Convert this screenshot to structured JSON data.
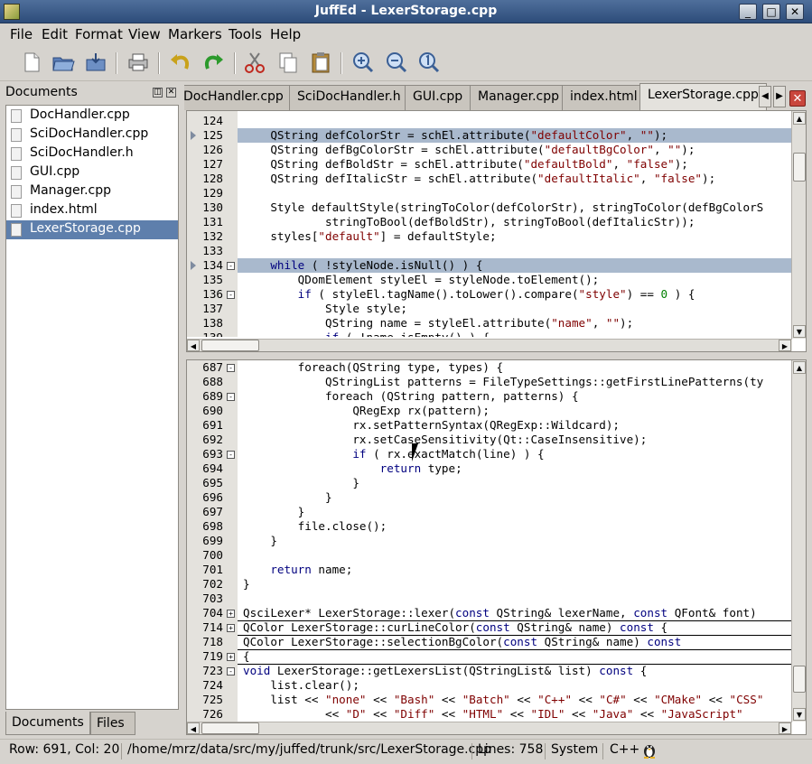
{
  "window": {
    "title": "JuffEd - LexerStorage.cpp"
  },
  "menu": [
    "File",
    "Edit",
    "Format",
    "View",
    "Markers",
    "Tools",
    "Help"
  ],
  "toolbar": {
    "buttons": [
      "new-file",
      "open-file",
      "save-file",
      "print",
      "undo",
      "redo",
      "cut",
      "copy",
      "paste",
      "zoom-in",
      "zoom-out",
      "zoom-reset"
    ]
  },
  "documents_panel": {
    "title": "Documents",
    "files": [
      "DocHandler.cpp",
      "SciDocHandler.cpp",
      "SciDocHandler.h",
      "GUI.cpp",
      "Manager.cpp",
      "index.html",
      "LexerStorage.cpp"
    ],
    "selected": "LexerStorage.cpp",
    "bottom_tabs": [
      "Documents",
      "Files"
    ]
  },
  "tabs": [
    "DocHandler.cpp",
    "SciDocHandler.h",
    "GUI.cpp",
    "Manager.cpp",
    "index.html",
    "LexerStorage.cpp"
  ],
  "active_tab": "LexerStorage.cpp",
  "editor_top": {
    "lines": [
      {
        "n": "124",
        "html": ""
      },
      {
        "n": "125",
        "html": "    QString defColorStr = schEl.attribute(<span class=\"str\">\"defaultColor\"</span>, <span class=\"str\">\"\"</span>);",
        "hl": true,
        "marker": true
      },
      {
        "n": "126",
        "html": "    QString defBgColorStr = schEl.attribute(<span class=\"str\">\"defaultBgColor\"</span>, <span class=\"str\">\"\"</span>);"
      },
      {
        "n": "127",
        "html": "    QString defBoldStr = schEl.attribute(<span class=\"str\">\"defaultBold\"</span>, <span class=\"str\">\"false\"</span>);"
      },
      {
        "n": "128",
        "html": "    QString defItalicStr = schEl.attribute(<span class=\"str\">\"defaultItalic\"</span>, <span class=\"str\">\"false\"</span>);"
      },
      {
        "n": "129",
        "html": ""
      },
      {
        "n": "130",
        "html": "    Style defaultStyle(stringToColor(defColorStr), stringToColor(defBgColorS"
      },
      {
        "n": "131",
        "html": "            stringToBool(defBoldStr), stringToBool(defItalicStr));"
      },
      {
        "n": "132",
        "html": "    styles[<span class=\"str\">\"default\"</span>] = defaultStyle;"
      },
      {
        "n": "133",
        "html": ""
      },
      {
        "n": "134",
        "html": "    <span class=\"kw\">while</span> ( !styleNode.isNull() ) {",
        "hl": true,
        "marker": true,
        "fold": "-"
      },
      {
        "n": "135",
        "html": "        QDomElement styleEl = styleNode.toElement();"
      },
      {
        "n": "136",
        "html": "        <span class=\"kw\">if</span> ( styleEl.tagName().toLower().compare(<span class=\"str\">\"style\"</span>) == <span class=\"num\">0</span> ) {",
        "fold": "-"
      },
      {
        "n": "137",
        "html": "            Style style;"
      },
      {
        "n": "138",
        "html": "            QString name = styleEl.attribute(<span class=\"str\">\"name\"</span>, <span class=\"str\">\"\"</span>);"
      },
      {
        "n": "139",
        "html": "            <span class=\"kw\">if</span> ( !name.isEmpty() ) {"
      }
    ]
  },
  "editor_bottom": {
    "lines": [
      {
        "n": "687",
        "html": "        foreach(QString type, types) {",
        "fold": "-"
      },
      {
        "n": "688",
        "html": "            QStringList patterns = FileTypeSettings::getFirstLinePatterns(ty"
      },
      {
        "n": "689",
        "html": "            foreach (QString pattern, patterns) {",
        "fold": "-"
      },
      {
        "n": "690",
        "html": "                QRegExp rx(pattern);"
      },
      {
        "n": "691",
        "html": "                rx.setPatternSyntax(QRegExp::Wildcard);"
      },
      {
        "n": "692",
        "html": "                rx.setCaseSensitivity(Qt::CaseInsensitive);"
      },
      {
        "n": "693",
        "html": "                <span class=\"kw\">if</span> ( rx.exactMatch(line) ) {",
        "fold": "-"
      },
      {
        "n": "694",
        "html": "                    <span class=\"kw\">return</span> type;"
      },
      {
        "n": "695",
        "html": "                }"
      },
      {
        "n": "696",
        "html": "            }"
      },
      {
        "n": "697",
        "html": "        }"
      },
      {
        "n": "698",
        "html": "        file.close();"
      },
      {
        "n": "699",
        "html": "    }"
      },
      {
        "n": "700",
        "html": ""
      },
      {
        "n": "701",
        "html": "    <span class=\"kw\">return</span> name;"
      },
      {
        "n": "702",
        "html": "}"
      },
      {
        "n": "703",
        "html": ""
      },
      {
        "n": "704",
        "html": "QsciLexer* LexerStorage::lexer(<span class=\"kw\">const</span> QString&amp; lexerName, <span class=\"kw\">const</span> QFont&amp; font)",
        "fold": "+",
        "folded": true
      },
      {
        "n": "714",
        "html": "QColor LexerStorage::curLineColor(<span class=\"kw\">const</span> QString&amp; name) <span class=\"kw\">const</span> {",
        "fold": "+",
        "folded": true
      },
      {
        "n": "718",
        "html": "QColor LexerStorage::selectionBgColor(<span class=\"kw\">const</span> QString&amp; name) <span class=\"kw\">const</span>",
        "folded": true
      },
      {
        "n": "719",
        "html": "{",
        "fold": "+",
        "folded": true
      },
      {
        "n": "723",
        "html": "<span class=\"kw\">void</span> LexerStorage::getLexersList(QStringList&amp; list) <span class=\"kw\">const</span> {",
        "fold": "-"
      },
      {
        "n": "724",
        "html": "    list.clear();"
      },
      {
        "n": "725",
        "html": "    list &lt;&lt; <span class=\"str\">\"none\"</span> &lt;&lt; <span class=\"str\">\"Bash\"</span> &lt;&lt; <span class=\"str\">\"Batch\"</span> &lt;&lt; <span class=\"str\">\"C++\"</span> &lt;&lt; <span class=\"str\">\"C#\"</span> &lt;&lt; <span class=\"str\">\"CMake\"</span> &lt;&lt; <span class=\"str\">\"CSS\"</span>"
      },
      {
        "n": "726",
        "html": "            &lt;&lt; <span class=\"str\">\"D\"</span> &lt;&lt; <span class=\"str\">\"Diff\"</span> &lt;&lt; <span class=\"str\">\"HTML\"</span> &lt;&lt; <span class=\"str\">\"IDL\"</span> &lt;&lt; <span class=\"str\">\"Java\"</span> &lt;&lt; <span class=\"str\">\"JavaScript\"</span>"
      }
    ]
  },
  "status": {
    "position": "Row: 691, Col: 20",
    "path": "/home/mrz/data/src/my/juffed/trunk/src/LexerStorage.cpp",
    "lines": "Lines: 758",
    "charset": "System",
    "language": "C++"
  },
  "colors": {
    "highlight": "#a9b9cd",
    "keyword": "#00007f",
    "string": "#7f0000",
    "number": "#007f00",
    "selection": "#5e7fac"
  }
}
